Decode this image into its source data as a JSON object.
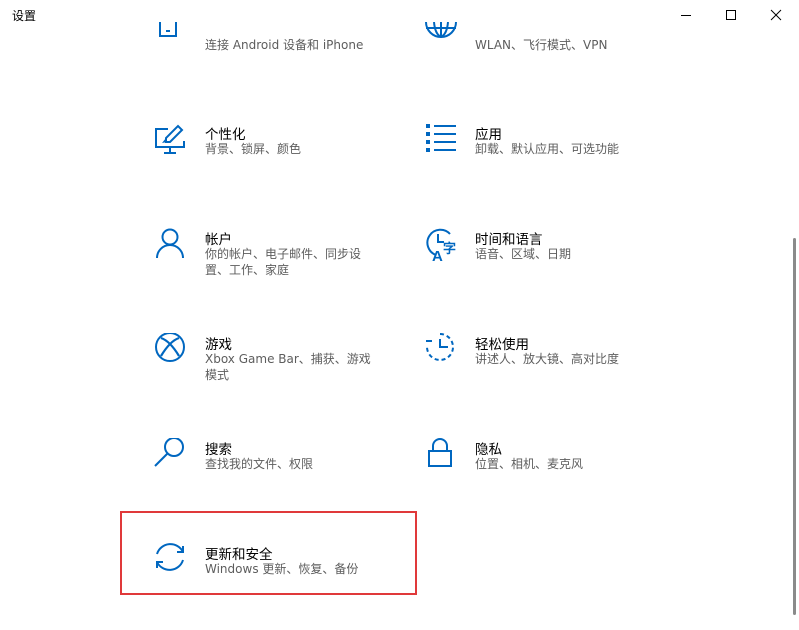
{
  "window": {
    "title": "设置",
    "controls": [
      "minimize",
      "maximize",
      "close"
    ]
  },
  "tiles": {
    "phone": {
      "desc": "连接 Android 设备和 iPhone",
      "icon": "phone-icon"
    },
    "network": {
      "desc": "WLAN、飞行模式、VPN",
      "icon": "globe-icon"
    },
    "personalization": {
      "name": "个性化",
      "desc": "背景、锁屏、颜色",
      "icon": "personalization-icon"
    },
    "apps": {
      "name": "应用",
      "desc": "卸载、默认应用、可选功能",
      "icon": "apps-list-icon"
    },
    "accounts": {
      "name": "帐户",
      "desc": "你的帐户、电子邮件、同步设置、工作、家庭",
      "icon": "person-icon"
    },
    "time_language": {
      "name": "时间和语言",
      "desc": "语音、区域、日期",
      "icon": "time-language-icon"
    },
    "gaming": {
      "name": "游戏",
      "desc": "Xbox Game Bar、捕获、游戏模式",
      "icon": "xbox-icon"
    },
    "ease_of_access": {
      "name": "轻松使用",
      "desc": "讲述人、放大镜、高对比度",
      "icon": "ease-of-access-icon"
    },
    "search": {
      "name": "搜索",
      "desc": "查找我的文件、权限",
      "icon": "search-icon"
    },
    "privacy": {
      "name": "隐私",
      "desc": "位置、相机、麦克风",
      "icon": "lock-icon"
    },
    "update_security": {
      "name": "更新和安全",
      "desc": "Windows 更新、恢复、备份",
      "icon": "sync-arrows-icon"
    }
  },
  "colors": {
    "accent": "#0067c0",
    "highlight_border": "#e0393a",
    "desc_text": "#5d5d5d"
  }
}
